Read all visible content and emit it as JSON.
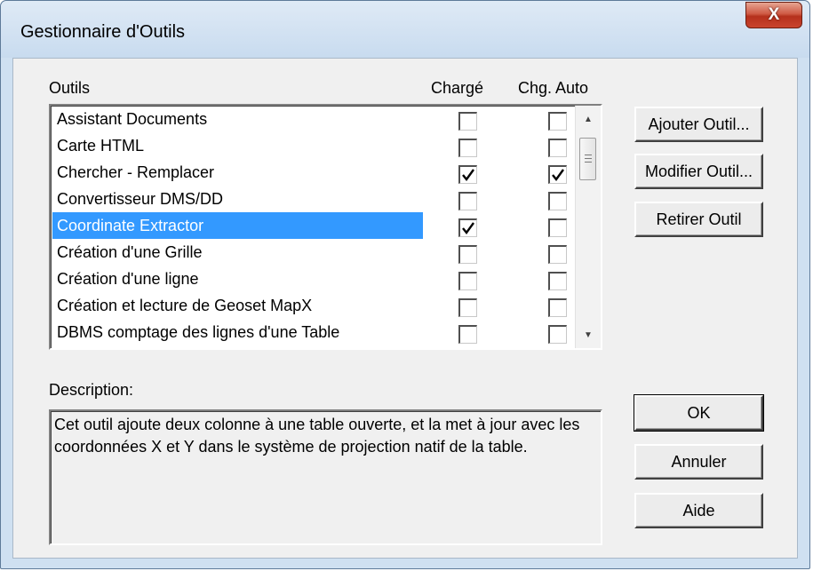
{
  "window": {
    "title": "Gestionnaire d'Outils",
    "close_label": "X"
  },
  "columns": {
    "tools": "Outils",
    "loaded": "Chargé",
    "autoload": "Chg. Auto"
  },
  "tools": [
    {
      "name": "Assistant Documents",
      "loaded": false,
      "autoload": false,
      "selected": false
    },
    {
      "name": "Carte HTML",
      "loaded": false,
      "autoload": false,
      "selected": false
    },
    {
      "name": "Chercher - Remplacer",
      "loaded": true,
      "autoload": true,
      "selected": false
    },
    {
      "name": "Convertisseur DMS/DD",
      "loaded": false,
      "autoload": false,
      "selected": false
    },
    {
      "name": "Coordinate Extractor",
      "loaded": true,
      "autoload": false,
      "selected": true
    },
    {
      "name": "Création d'une Grille",
      "loaded": false,
      "autoload": false,
      "selected": false
    },
    {
      "name": "Création d'une ligne",
      "loaded": false,
      "autoload": false,
      "selected": false
    },
    {
      "name": "Création et lecture de Geoset MapX",
      "loaded": false,
      "autoload": false,
      "selected": false
    },
    {
      "name": "DBMS comptage des lignes d'une Table",
      "loaded": false,
      "autoload": false,
      "selected": false
    }
  ],
  "side_buttons": {
    "add": "Ajouter Outil...",
    "modify": "Modifier Outil...",
    "remove": "Retirer Outil"
  },
  "description": {
    "label": "Description:",
    "text": "Cet outil ajoute deux colonne à une table ouverte, et la met à jour avec les coordonnées X et Y dans le système de projection natif de la table."
  },
  "dialog_buttons": {
    "ok": "OK",
    "cancel": "Annuler",
    "help": "Aide"
  },
  "colors": {
    "selection": "#3399ff",
    "close_button": "#c9442e"
  }
}
